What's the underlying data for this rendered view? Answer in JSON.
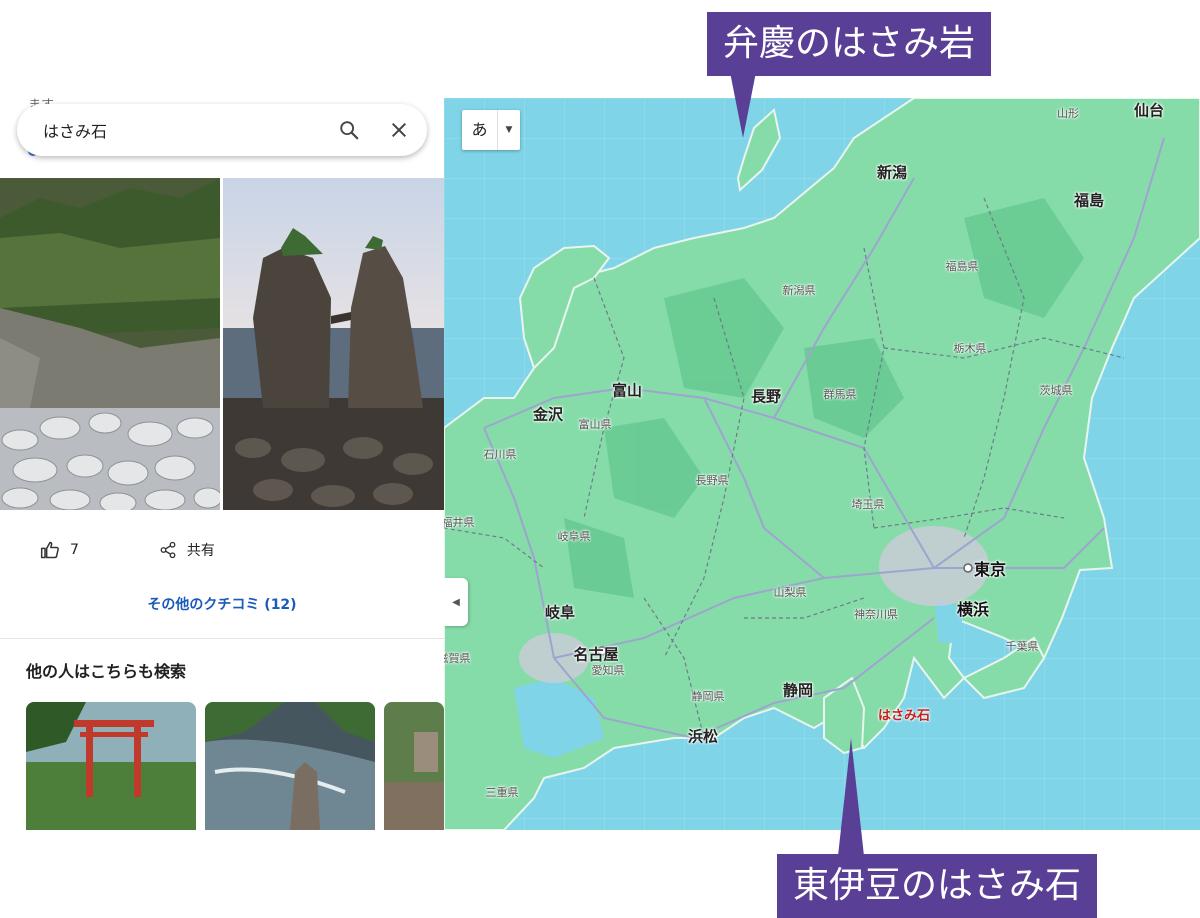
{
  "search": {
    "query": "はさみ石"
  },
  "panel": {
    "top_stub_text": "ます",
    "like_count": "7",
    "share_label": "共有",
    "more_reviews_label": "その他のクチコミ (12)",
    "related_title": "他の人はこちらも検索"
  },
  "map": {
    "language_button": "あ",
    "marker_label": "はさみ石",
    "city_labels": [
      "仙台",
      "新潟",
      "福島",
      "富山",
      "金沢",
      "長野",
      "岐阜",
      "名古屋",
      "静岡",
      "浜松"
    ],
    "capital_labels": [
      "東京",
      "横浜"
    ],
    "small_labels": [
      "山形"
    ],
    "prefecture_labels": [
      "福島県",
      "新潟県",
      "栃木県",
      "群馬県",
      "茨城県",
      "富山県",
      "石川県",
      "長野県",
      "埼玉県",
      "福井県",
      "岐阜県",
      "山梨県",
      "神奈川県",
      "千葉県",
      "愛知県",
      "静岡県",
      "三重県",
      "滋賀県"
    ]
  },
  "callouts": {
    "top": "弁慶のはさみ岩",
    "bottom": "東伊豆のはさみ石"
  },
  "colors": {
    "water": "#7fd4e8",
    "land": "#7fd9a4",
    "callout_bg": "#5a3f96",
    "link": "#1a5ab8",
    "marker": "#c5221f"
  }
}
